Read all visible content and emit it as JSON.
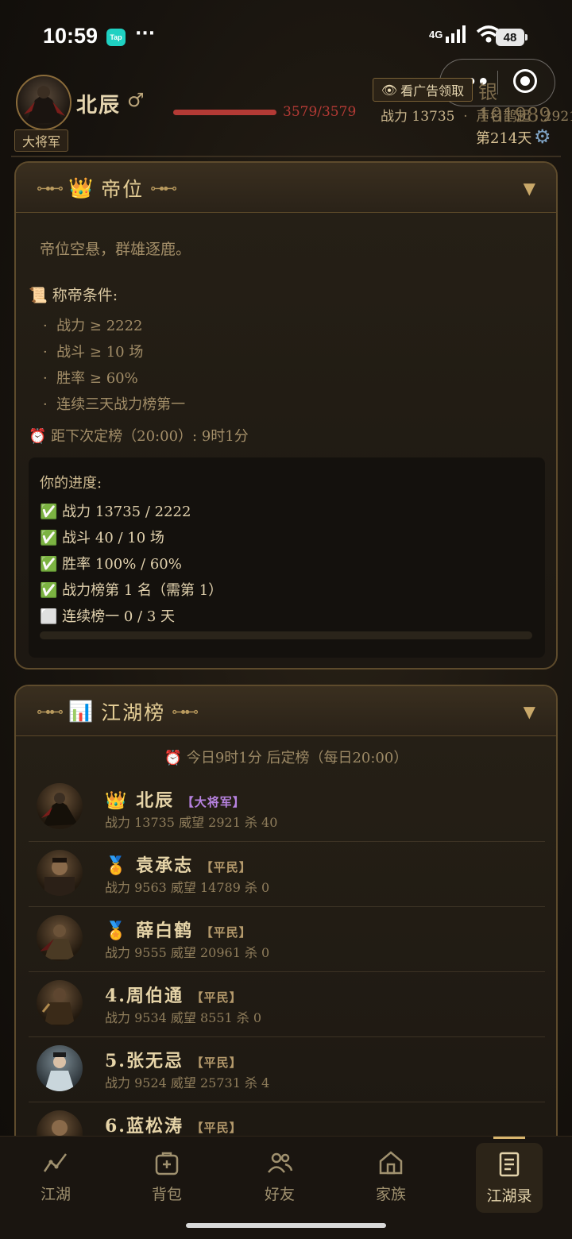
{
  "status_bar": {
    "time": "10:59",
    "tap_label": "Tap",
    "more": "···",
    "network": "4G",
    "battery": "48"
  },
  "player": {
    "name": "北辰",
    "gender": "♂",
    "rank": "大将军",
    "hp_text": "3579/3579",
    "ad_button": "看广告领取",
    "silver": "银 101989",
    "power": "战力 13735",
    "fame": "声名鹊起 · 2921",
    "day": "第214天"
  },
  "throne": {
    "title": "帝位",
    "status": "帝位空悬，群雄逐鹿。",
    "conditions_title": "称帝条件:",
    "conditions": [
      "战力 ≥ 2222",
      "战斗 ≥ 10 场",
      "胜率 ≥ 60%",
      "连续三天战力榜第一"
    ],
    "next_ranking": "距下次定榜（20:00）: 9时1分",
    "progress_title": "你的进度:",
    "progress": [
      {
        "icon": "✅",
        "text": "战力 13735 / 2222"
      },
      {
        "icon": "✅",
        "text": "战斗 40 / 10 场"
      },
      {
        "icon": "✅",
        "text": "胜率 100% / 60%"
      },
      {
        "icon": "✅",
        "text": "战力榜第 1 名（需第 1）"
      },
      {
        "icon": "⬜",
        "text": "连续榜一 0 / 3 天"
      }
    ],
    "streak_progress": 0
  },
  "ranking": {
    "title": "江湖榜",
    "notice": "今日9时1分 后定榜（每日20:00）",
    "entries": [
      {
        "prefix": "👑",
        "name": "北辰",
        "title": "【大将军】",
        "stats": "战力 13735   威望 2921   杀 40"
      },
      {
        "prefix": "🏅",
        "name": "袁承志",
        "title": "【平民】",
        "stats": "战力 9563   威望 14789   杀 0"
      },
      {
        "prefix": "🏅",
        "name": "薛白鹤",
        "title": "【平民】",
        "stats": "战力 9555   威望 20961   杀 0"
      },
      {
        "prefix": "4.",
        "name": "周伯通",
        "title": "【平民】",
        "stats": "战力 9534   威望 8551   杀 0"
      },
      {
        "prefix": "5.",
        "name": "张无忌",
        "title": "【平民】",
        "stats": "战力 9524   威望 25731   杀 4"
      },
      {
        "prefix": "6.",
        "name": "蓝松涛",
        "title": "【平民】",
        "stats": ""
      }
    ]
  },
  "nav": [
    {
      "label": "江湖",
      "icon": "trend-icon"
    },
    {
      "label": "背包",
      "icon": "bag-icon"
    },
    {
      "label": "好友",
      "icon": "friends-icon"
    },
    {
      "label": "家族",
      "icon": "home-icon"
    },
    {
      "label": "江湖录",
      "icon": "document-icon",
      "active": true
    }
  ]
}
